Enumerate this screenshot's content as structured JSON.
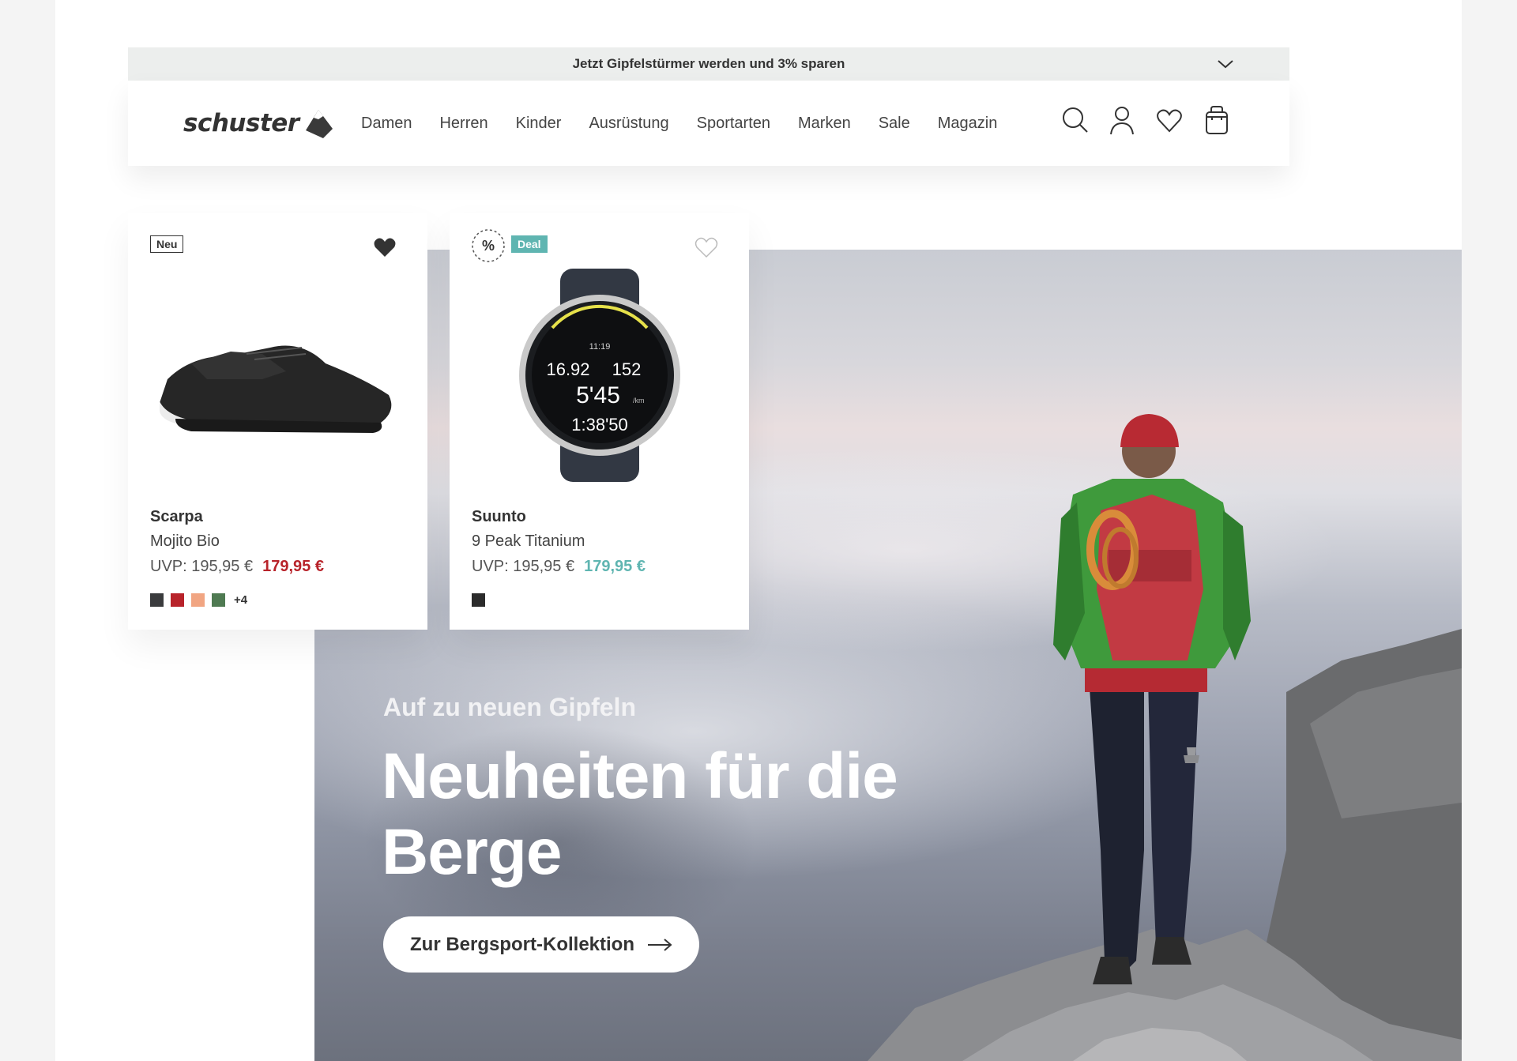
{
  "topbar": {
    "promo_text": "Jetzt Gipfelstürmer werden und 3% sparen",
    "chevron_icon": "chevron-down-icon"
  },
  "navbar": {
    "logo_text": "schuster",
    "nav_items": [
      "Damen",
      "Herren",
      "Kinder",
      "Ausrüstung",
      "Sportarten",
      "Marken",
      "Sale",
      "Magazin"
    ],
    "icons": [
      "search-icon",
      "user-icon",
      "heart-icon",
      "bag-icon"
    ]
  },
  "products": [
    {
      "badge": "Neu",
      "favorite": true,
      "brand": "Scarpa",
      "model": "Mojito Bio",
      "uvp": "UVP: 195,95 €",
      "sale_price": "179,95 €",
      "sale_color": "#b8232a",
      "swatches": [
        "#3a3b3d",
        "#b8232a",
        "#f1a582",
        "#4f7a52"
      ],
      "more_colors": "+4"
    },
    {
      "badge": "Deal",
      "badge_color": "#5fb5b1",
      "favorite": false,
      "brand": "Suunto",
      "model": "9 Peak Titanium",
      "uvp": "UVP: 195,95 €",
      "sale_price": "179,95 €",
      "sale_color": "#5fb5b1",
      "swatches": [
        "#2b2b2b"
      ],
      "watch": {
        "time": "11:19",
        "distance": "16.92",
        "heart_rate": "152",
        "pace": "5'45",
        "pace_unit": "/km",
        "duration": "1:38'50"
      }
    }
  ],
  "hero": {
    "subtitle": "Auf zu neuen Gipfeln",
    "title": "Neuheiten für die Berge",
    "cta_label": "Zur Bergsport-Kollektion",
    "cta_icon": "arrow-right-icon"
  }
}
